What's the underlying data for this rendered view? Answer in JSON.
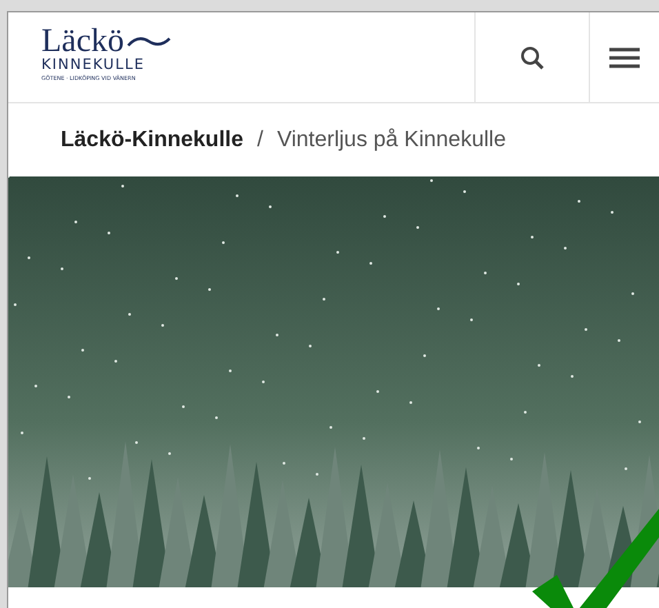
{
  "logo": {
    "name": "Läckö",
    "subtitle": "KINNEKULLE",
    "tagline": "GÖTENE · LIDKÖPING VID VÄNERN"
  },
  "breadcrumb": [
    {
      "label": "Läckö-Kinnekulle",
      "current": false
    },
    {
      "separator": "/",
      "label": "Vinterljus på Kinnekulle",
      "current": true
    }
  ]
}
